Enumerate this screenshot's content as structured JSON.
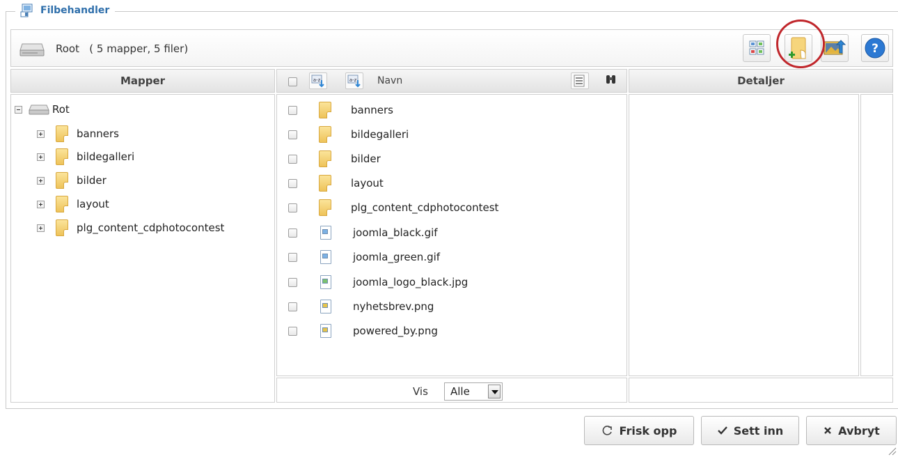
{
  "window": {
    "title": "Filbehandler"
  },
  "toolbar": {
    "path_label": "Root",
    "summary": "( 5 mapper, 5 filer)",
    "buttons": [
      "view-mode",
      "new-folder",
      "upload",
      "help"
    ]
  },
  "folders_pane": {
    "header": "Mapper",
    "root": "Rot",
    "items": [
      "banners",
      "bildegalleri",
      "bilder",
      "layout",
      "plg_content_cdphotocontest"
    ]
  },
  "files_pane": {
    "name_header": "Navn",
    "folders": [
      "banners",
      "bildegalleri",
      "bilder",
      "layout",
      "plg_content_cdphotocontest"
    ],
    "files": [
      {
        "name": "joomla_black.gif",
        "icon": "blue"
      },
      {
        "name": "joomla_green.gif",
        "icon": "blue"
      },
      {
        "name": "joomla_logo_black.jpg",
        "icon": "green"
      },
      {
        "name": "nyhetsbrev.png",
        "icon": "yellow"
      },
      {
        "name": "powered_by.png",
        "icon": "yellow"
      }
    ],
    "filter_label": "Vis",
    "filter_value": "Alle"
  },
  "details_pane": {
    "header": "Detaljer"
  },
  "actions": {
    "refresh": "Frisk opp",
    "insert": "Sett inn",
    "cancel": "Avbryt"
  },
  "colors": {
    "accent_circle": "#c0262b",
    "title_blue": "#2f6fab"
  }
}
